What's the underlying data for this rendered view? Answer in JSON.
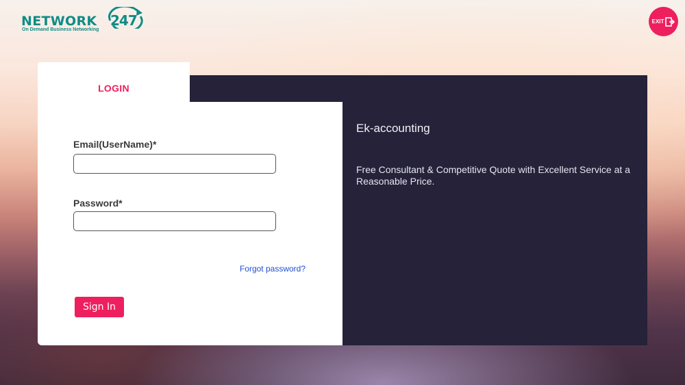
{
  "brand": {
    "name": "NETWORK",
    "number": "247",
    "tagline": "On Demand Business Networking",
    "color": "#0f8c85"
  },
  "exit": {
    "label": "EXIT",
    "icon": "exit-door-icon",
    "color": "#ee1f5e"
  },
  "login": {
    "tab_label": "LOGIN",
    "email_label": "Email(UserName)*",
    "email_value": "",
    "password_label": "Password*",
    "password_value": "",
    "forgot_label": "Forgot password?",
    "signin_label": "Sign In",
    "accent": "#ee1f5e"
  },
  "info": {
    "title": "Ek-accounting",
    "description": "Free Consultant & Competitive Quote with Excellent Service at a Reasonable Price.",
    "background": "#25223a"
  }
}
